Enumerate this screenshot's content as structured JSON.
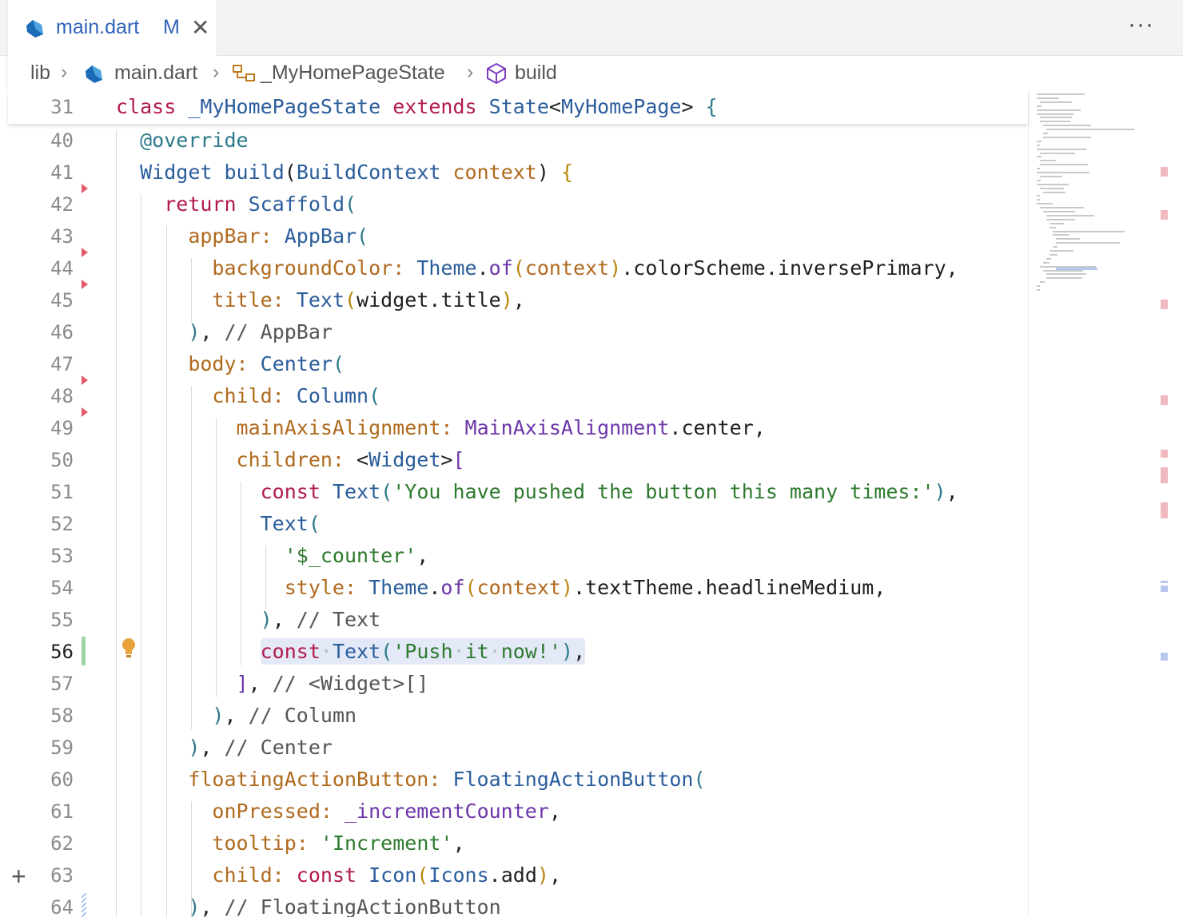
{
  "tab": {
    "filename": "main.dart",
    "modified": "M",
    "close": "✕"
  },
  "toolbar": {
    "more": "···"
  },
  "breadcrumb": {
    "root": "lib",
    "file": "main.dart",
    "class": "_MyHomePageState",
    "method": "build"
  },
  "editor": {
    "sticky": {
      "number": "31"
    },
    "lines": [
      {
        "n": "40"
      },
      {
        "n": "41"
      },
      {
        "n": "42"
      },
      {
        "n": "43"
      },
      {
        "n": "44"
      },
      {
        "n": "45"
      },
      {
        "n": "46"
      },
      {
        "n": "47"
      },
      {
        "n": "48"
      },
      {
        "n": "49"
      },
      {
        "n": "50"
      },
      {
        "n": "51"
      },
      {
        "n": "52"
      },
      {
        "n": "53"
      },
      {
        "n": "54"
      },
      {
        "n": "55"
      },
      {
        "n": "56"
      },
      {
        "n": "57"
      },
      {
        "n": "58"
      },
      {
        "n": "59"
      },
      {
        "n": "60"
      },
      {
        "n": "61"
      },
      {
        "n": "62"
      },
      {
        "n": "63"
      },
      {
        "n": "64"
      }
    ]
  },
  "gutter": {
    "add": "+"
  }
}
